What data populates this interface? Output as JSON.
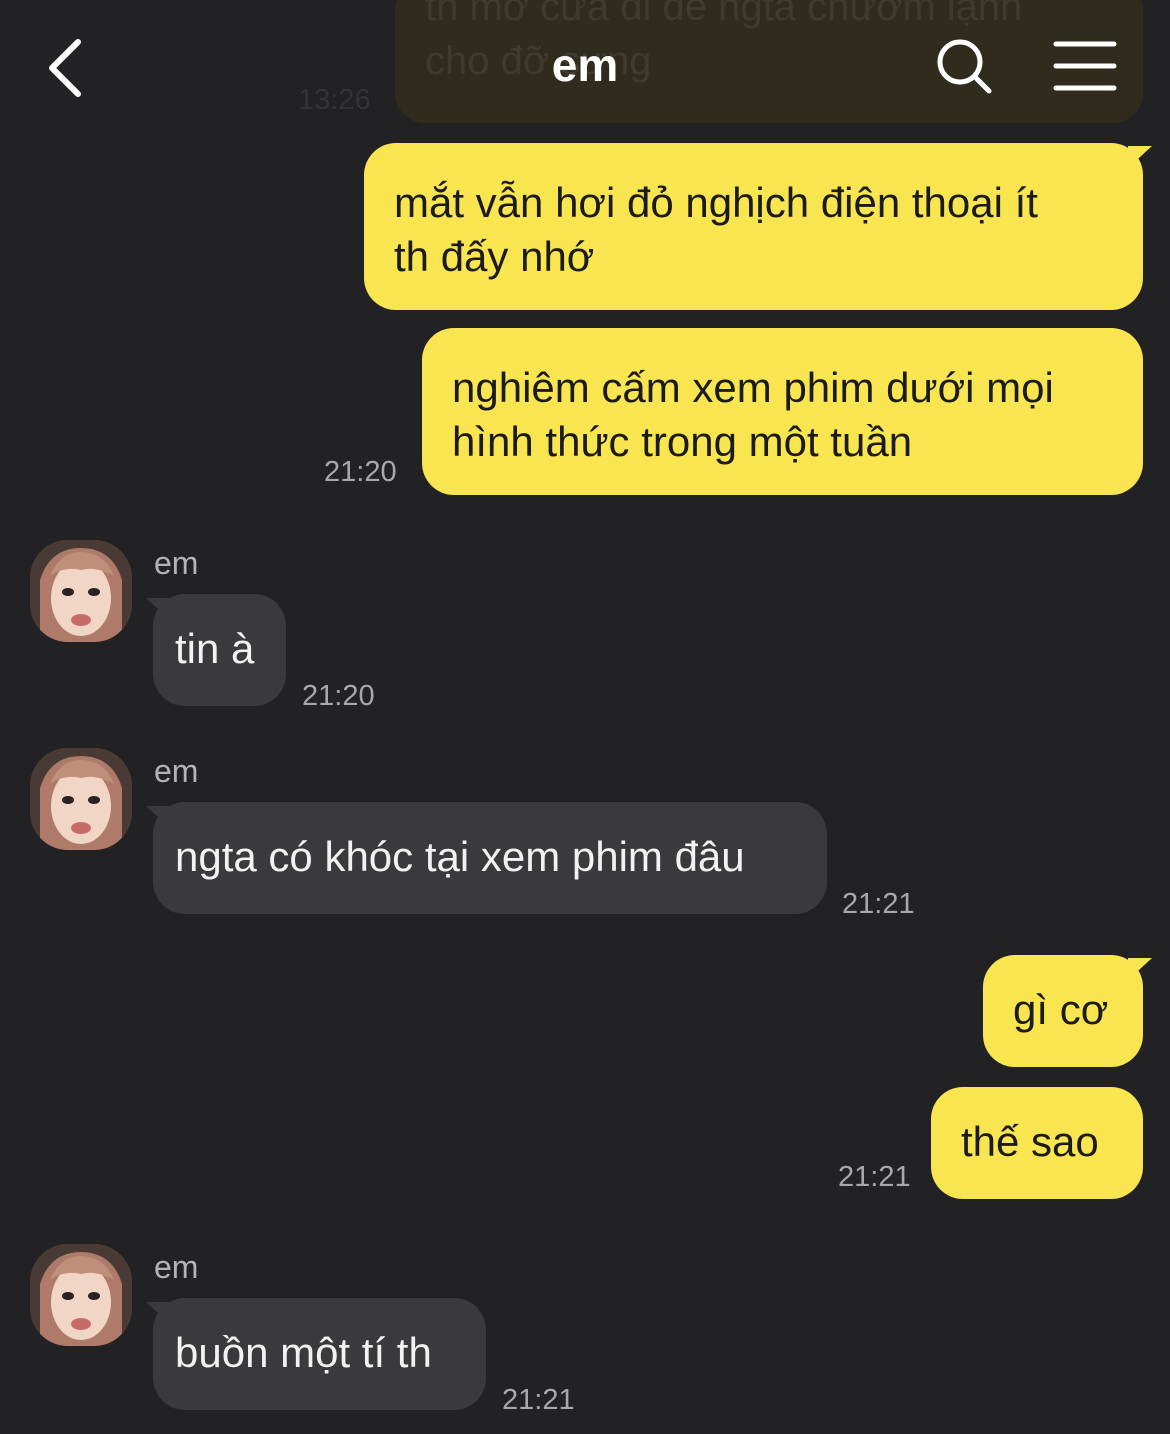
{
  "header": {
    "title": "em",
    "back_icon": "chevron-left-icon",
    "search_icon": "search-icon",
    "menu_icon": "hamburger-menu-icon"
  },
  "faded_message": {
    "lines": [
      "th mở cửa đi để ngta chườm lạnh",
      "cho đỡ sưng"
    ],
    "time": "13:26"
  },
  "messages": [
    {
      "side": "out",
      "text_lines": [
        "mắt vẫn hơi đỏ nghịch điện thoại ít",
        "th đấy nhớ"
      ],
      "time": ""
    },
    {
      "side": "out",
      "text_lines": [
        "nghiêm cấm xem phim dưới mọi",
        "hình thức trong một tuần"
      ],
      "time": "21:20"
    },
    {
      "side": "in",
      "sender": "em",
      "text_lines": [
        "tin à"
      ],
      "time": "21:20"
    },
    {
      "side": "in",
      "sender": "em",
      "text_lines": [
        "ngta có khóc tại xem phim đâu"
      ],
      "time": "21:21"
    },
    {
      "side": "out",
      "text_lines": [
        "gì cơ"
      ],
      "time": ""
    },
    {
      "side": "out",
      "text_lines": [
        "thế sao"
      ],
      "time": "21:21"
    },
    {
      "side": "in",
      "sender": "em",
      "text_lines": [
        "buồn một tí th"
      ],
      "time": "21:21"
    }
  ],
  "colors": {
    "background": "#222224",
    "outgoing_bubble": "#f9e550",
    "incoming_bubble": "#3a3a3c",
    "timestamp": "#a8a8aa"
  }
}
